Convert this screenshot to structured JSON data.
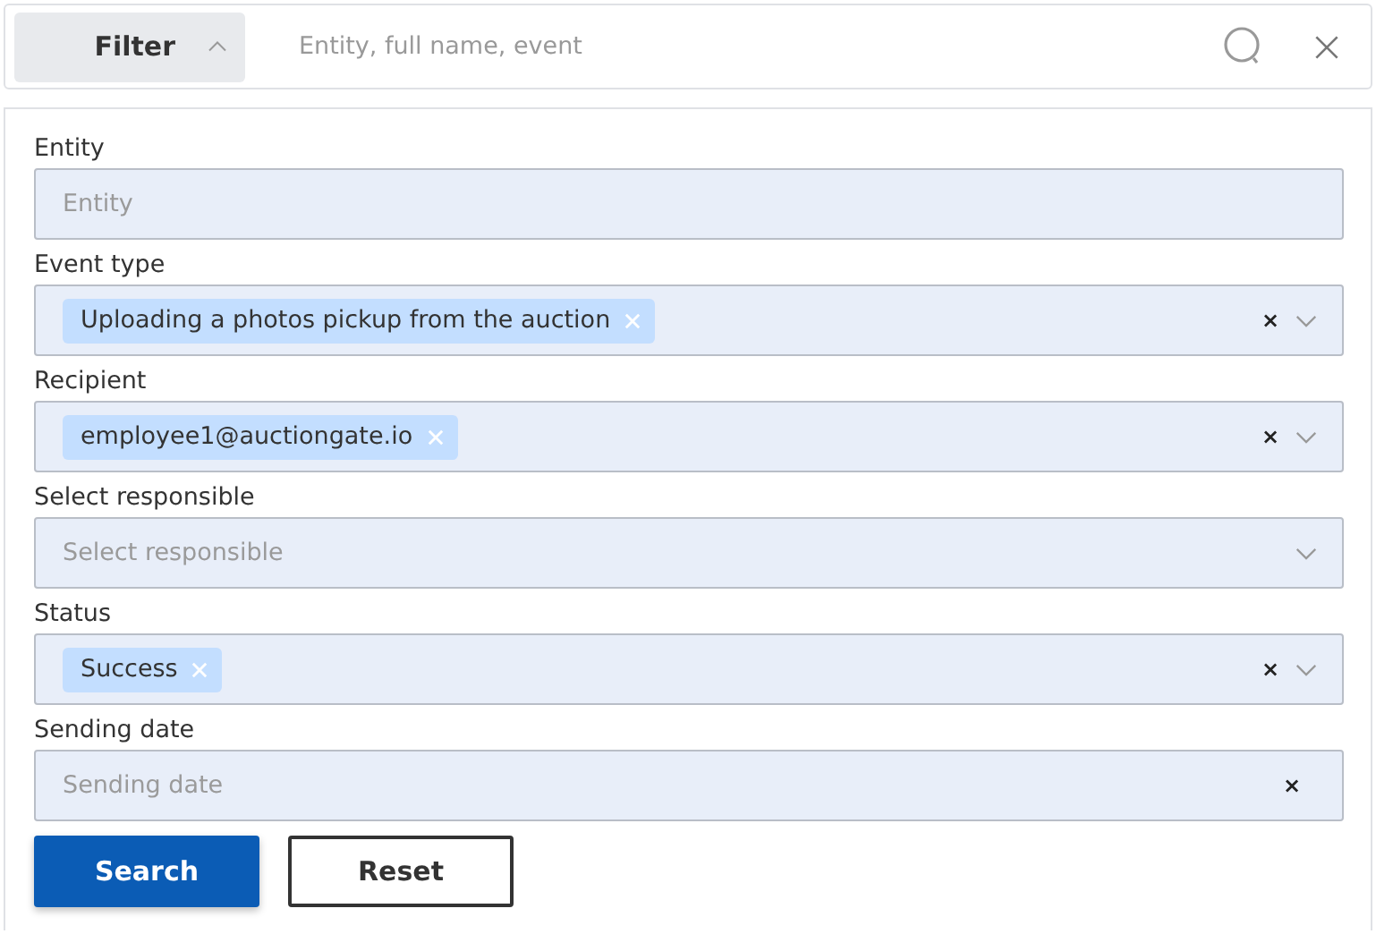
{
  "search_bar": {
    "filter_button": {
      "label": "Filter",
      "expanded": true
    },
    "search": {
      "placeholder": "Entity, full name, event"
    }
  },
  "filter_panel": {
    "fields": [
      {
        "label": "Entity",
        "kind": "input",
        "placeholder": "Entity"
      },
      {
        "label": "Event type",
        "kind": "multiselect",
        "tags": [
          "Uploading a photos pickup from the auction"
        ],
        "clear": "×"
      },
      {
        "label": "Recipient",
        "kind": "multiselect",
        "tags": [
          "employee1@auctiongate.io"
        ],
        "clear": "×"
      },
      {
        "label": "Select responsible",
        "kind": "select",
        "placeholder": "Select responsible"
      },
      {
        "label": "Status",
        "kind": "multiselect",
        "tags": [
          "Success"
        ],
        "clear": "×"
      },
      {
        "label": "Sending date",
        "kind": "date",
        "placeholder": "Sending date",
        "clear": "×"
      }
    ],
    "buttons": [
      {
        "label": "Search",
        "kind": "primary"
      },
      {
        "label": "Reset",
        "kind": "secondary"
      }
    ]
  }
}
